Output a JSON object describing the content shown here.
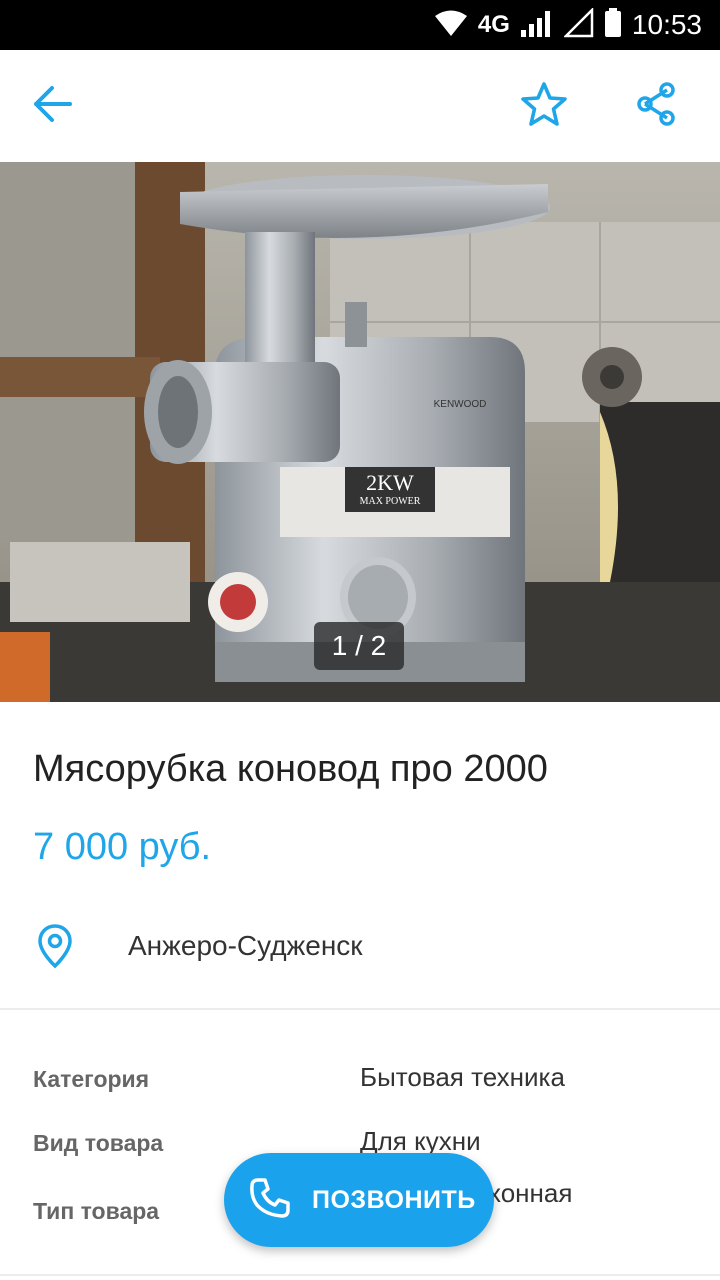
{
  "status_bar": {
    "network": "4G",
    "time": "10:53"
  },
  "app_bar": {
    "back_icon": "arrow-back-icon",
    "favorite_icon": "star-outline-icon",
    "share_icon": "share-icon",
    "accent_color": "#1ea6e8"
  },
  "gallery": {
    "counter": "1 / 2"
  },
  "listing": {
    "title": "Мясорубка коновод про 2000",
    "price": "7 000 руб.",
    "location": "Анжеро-Судженск"
  },
  "properties": [
    {
      "label": "Категория",
      "value": "Бытовая техника"
    },
    {
      "label": "Вид товара",
      "value": "Для кухни"
    },
    {
      "label": "Тип товара",
      "value": "хонная"
    }
  ],
  "call_button": {
    "label": "ПОЗВОНИТЬ",
    "color": "#1aa2ec"
  }
}
